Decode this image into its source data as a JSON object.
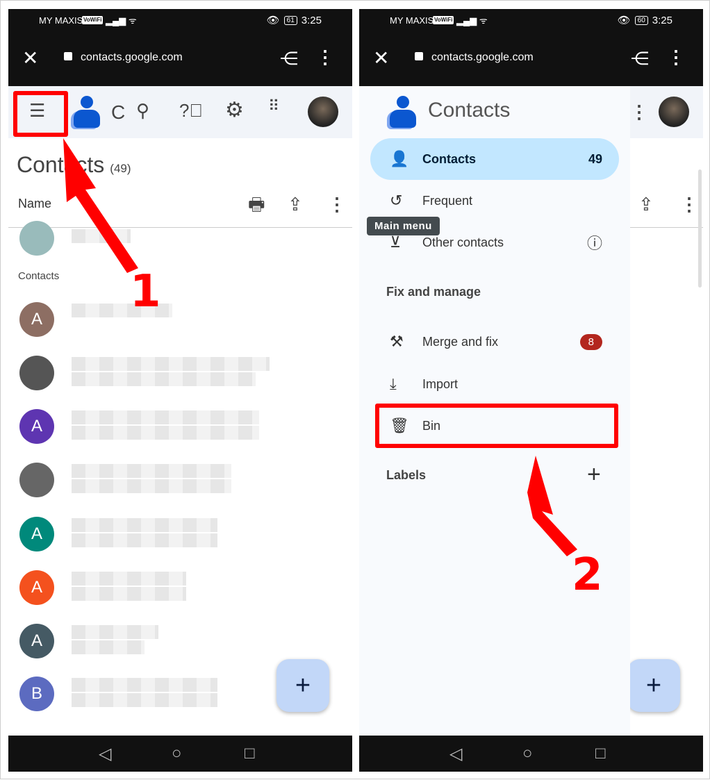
{
  "left": {
    "status": {
      "carrier": "MY MAXIS",
      "vowifi": "VoWiFi",
      "battery": "61",
      "time": "3:25"
    },
    "browser": {
      "url": "contacts.google.com"
    },
    "appbar": {
      "partial_title": "C"
    },
    "page": {
      "title": "Contacts",
      "count": "(49)",
      "name_header": "Name",
      "section_label": "Contacts"
    },
    "contacts": [
      {
        "initial": "A",
        "color": "#8d6e63"
      },
      {
        "initial": "",
        "color": "#555"
      },
      {
        "initial": "A",
        "color": "#5e35b1"
      },
      {
        "initial": "",
        "color": "#666"
      },
      {
        "initial": "A",
        "color": "#00897b"
      },
      {
        "initial": "A",
        "color": "#f4511e"
      },
      {
        "initial": "A",
        "color": "#455a64"
      },
      {
        "initial": "B",
        "color": "#5c6bc0"
      }
    ],
    "fab": "+"
  },
  "right": {
    "status": {
      "carrier": "MY MAXIS",
      "vowifi": "VoWiFi",
      "battery": "60",
      "time": "3:25"
    },
    "browser": {
      "url": "contacts.google.com"
    },
    "drawer": {
      "app_name": "Contacts",
      "tooltip": "Main menu",
      "items": [
        {
          "label": "Contacts",
          "count": "49",
          "active": true
        },
        {
          "label": "Frequent"
        },
        {
          "label": "Other contacts"
        }
      ],
      "fix_section": "Fix and manage",
      "fix_items": [
        {
          "label": "Merge and fix",
          "badge": "8"
        },
        {
          "label": "Import"
        },
        {
          "label": "Bin"
        }
      ],
      "labels_section": "Labels",
      "add": "+"
    },
    "fab": "+"
  },
  "annotations": {
    "step1": "1",
    "step2": "2",
    "color": "#ff0000"
  }
}
